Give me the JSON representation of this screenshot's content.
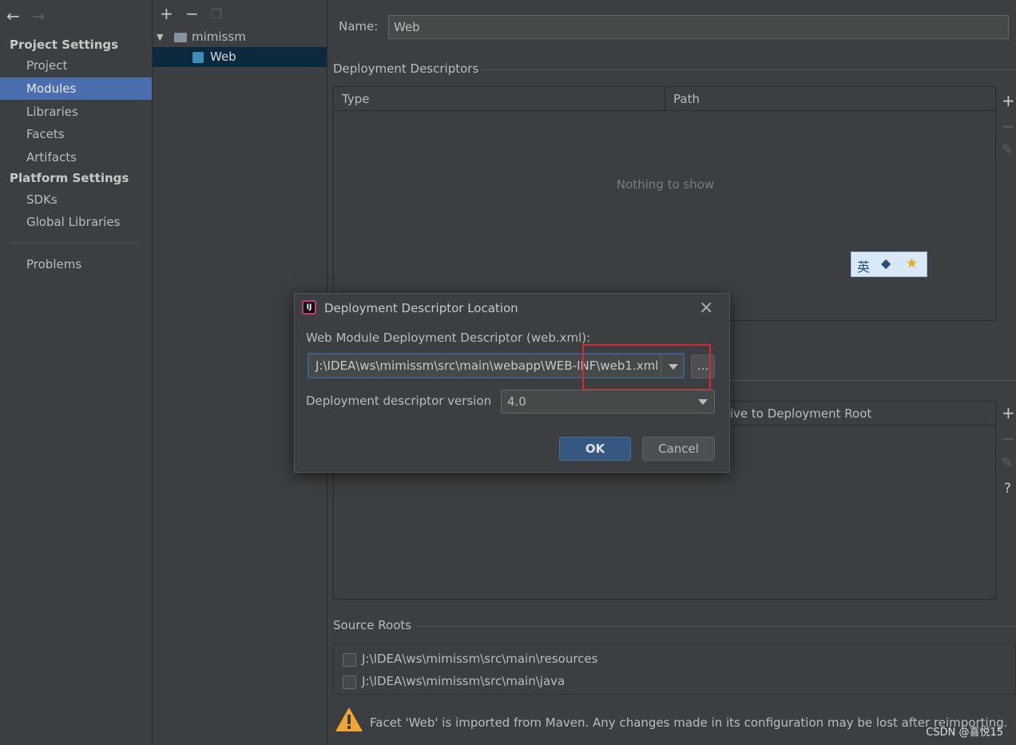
{
  "settings_nav": {
    "back_icon": "arrow-left-icon",
    "forward_icon": "arrow-right-icon",
    "project_settings_title": "Project Settings",
    "project_items": [
      "Project",
      "Modules",
      "Libraries",
      "Facets",
      "Artifacts"
    ],
    "selected": "Modules",
    "platform_settings_title": "Platform Settings",
    "platform_items": [
      "SDKs",
      "Global Libraries"
    ],
    "problems": "Problems"
  },
  "tree": {
    "toolbar_icons": [
      "plus-icon",
      "minus-icon",
      "copy-icon"
    ],
    "root": "mimissm",
    "child": "Web"
  },
  "facet": {
    "name_label": "Name:",
    "name_value": "Web",
    "deployment_descriptors_title": "Deployment Descriptors",
    "col_type": "Type",
    "col_path": "Path",
    "empty_text": "Nothing to show",
    "web_resource_col_partial": "tive to Deployment Root",
    "source_roots_title": "Source Roots",
    "source_roots": [
      "J:\\IDEA\\ws\\mimissm\\src\\main\\resources",
      "J:\\IDEA\\ws\\mimissm\\src\\main\\java"
    ],
    "warning": "Facet 'Web' is imported from Maven. Any changes made in its configuration may be lost after reimporting.",
    "side_tools": [
      "plus-icon",
      "minus-icon",
      "edit-icon",
      "help-icon"
    ]
  },
  "ime_toolbar": {
    "lang": "英"
  },
  "dialog": {
    "title": "Deployment Descriptor Location",
    "descriptor_label": "Web Module Deployment Descriptor (web.xml):",
    "descriptor_value": "J:\\IDEA\\ws\\mimissm\\src\\main\\webapp\\WEB-INF\\web1.xml",
    "browse_label": "...",
    "version_label": "Deployment descriptor version",
    "version_value": "4.0",
    "ok_label": "OK",
    "cancel_label": "Cancel"
  },
  "watermark": "CSDN @喜悦15",
  "colors": {
    "background": "#3c3f41",
    "selection": "#4b6eaf",
    "highlight_box": "#e0262c",
    "primary_button": "#365880"
  }
}
